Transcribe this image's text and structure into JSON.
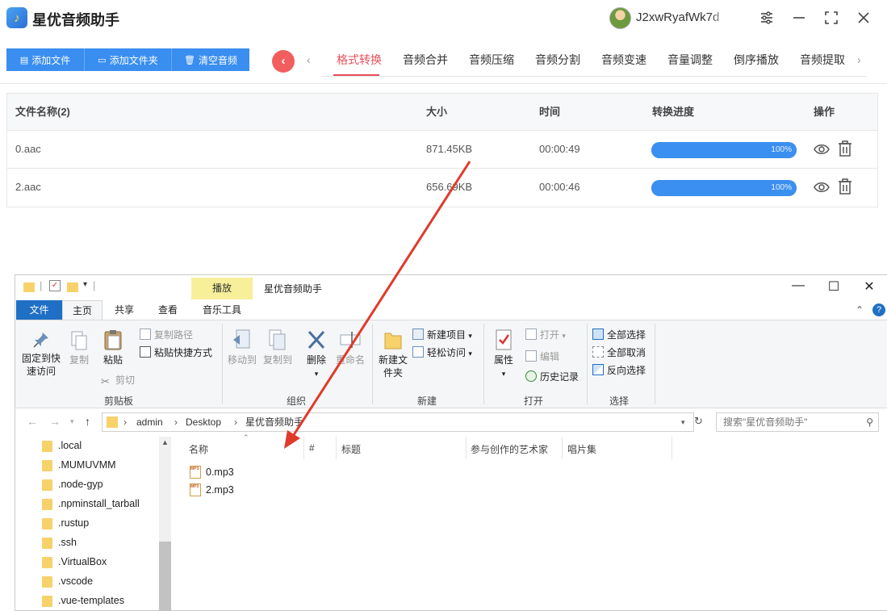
{
  "app": {
    "title": "星优音频助手",
    "username": "J2xwRyafWk7d",
    "toolbar": [
      {
        "label": "添加文件",
        "icon": "file-icon"
      },
      {
        "label": "添加文件夹",
        "icon": "folder-icon"
      },
      {
        "label": "清空音频",
        "icon": "trash-icon"
      }
    ],
    "tabs": [
      "格式转换",
      "音频合并",
      "音频压缩",
      "音频分割",
      "音频变速",
      "音量调整",
      "倒序播放",
      "音频提取"
    ],
    "active_tab": "格式转换",
    "table": {
      "headers": {
        "name": "文件名称(2)",
        "size": "大小",
        "time": "时间",
        "progress": "转换进度",
        "ops": "操作"
      },
      "rows": [
        {
          "name": "0.aac",
          "size": "871.45KB",
          "time": "00:00:49",
          "progress": 1.0,
          "progress_text": "100%"
        },
        {
          "name": "2.aac",
          "size": "656.69KB",
          "time": "00:00:46",
          "progress": 1.0,
          "progress_text": "100%"
        }
      ]
    },
    "colors": {
      "accent": "#3a8ef0",
      "tab_active": "#e8505b",
      "back_button": "#f25e5e",
      "annotation_arrow": "#e03a2a"
    }
  },
  "explorer": {
    "title": "星优音频助手",
    "context_tab": "播放",
    "ribbon_tabs": [
      "文件",
      "主页",
      "共享",
      "查看",
      "音乐工具"
    ],
    "ribbon": {
      "clipboard": {
        "pin": "固定到快速访问",
        "copy": "复制",
        "paste": "粘贴",
        "copy_path": "复制路径",
        "paste_shortcut": "粘贴快捷方式",
        "cut": "剪切",
        "label": "剪贴板"
      },
      "organize": {
        "move_to": "移动到",
        "copy_to": "复制到",
        "delete": "删除",
        "rename": "重命名",
        "label": "组织"
      },
      "new": {
        "new_folder": "新建文件夹",
        "new_item": "新建项目",
        "easy_access": "轻松访问",
        "label": "新建"
      },
      "open": {
        "properties": "属性",
        "open": "打开",
        "edit": "编辑",
        "history": "历史记录",
        "label": "打开"
      },
      "select": {
        "select_all": "全部选择",
        "select_none": "全部取消",
        "invert": "反向选择",
        "label": "选择"
      }
    },
    "address": {
      "parts": [
        "admin",
        "Desktop",
        "星优音频助手"
      ]
    },
    "search_placeholder": "搜索\"星优音频助手\"",
    "nav_items": [
      ".local",
      ".MUMUVMM",
      ".node-gyp",
      ".npminstall_tarball",
      ".rustup",
      ".ssh",
      ".VirtualBox",
      ".vscode",
      ".vue-templates"
    ],
    "columns": [
      "名称",
      "#",
      "标题",
      "参与创作的艺术家",
      "唱片集"
    ],
    "files": [
      "0.mp3",
      "2.mp3"
    ]
  }
}
